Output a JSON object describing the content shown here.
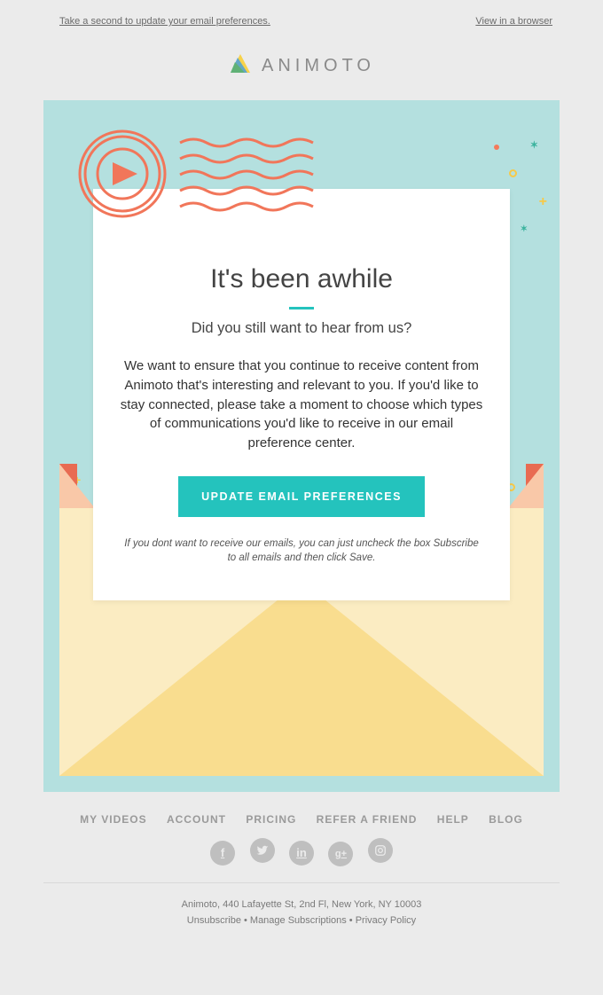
{
  "header": {
    "update_prefs_link": "Take a second to update your email preferences.",
    "view_browser_link": "View in a browser"
  },
  "brand": {
    "name": "ANIMOTO"
  },
  "card": {
    "heading": "It's been awhile",
    "subheading": "Did you still want to hear from us?",
    "body": "We want to ensure that you continue to receive content from Animoto that's interesting and relevant to you. If you'd like to stay connected, please take a moment to choose which types of communications you'd like to receive in our email preference center.",
    "cta_label": "UPDATE EMAIL PREFERENCES",
    "note": "If you dont want to receive our emails, you can just uncheck the box Subscribe to all emails and then click Save."
  },
  "footer_nav": {
    "items": [
      "MY VIDEOS",
      "ACCOUNT",
      "PRICING",
      "REFER A FRIEND",
      "HELP",
      "BLOG"
    ]
  },
  "footer_legal": {
    "address": "Animoto, 440 Lafayette St, 2nd Fl, New York, NY 10003",
    "links": [
      "Unsubscribe",
      "Manage Subscriptions",
      "Privacy Policy"
    ],
    "sep": " • "
  }
}
